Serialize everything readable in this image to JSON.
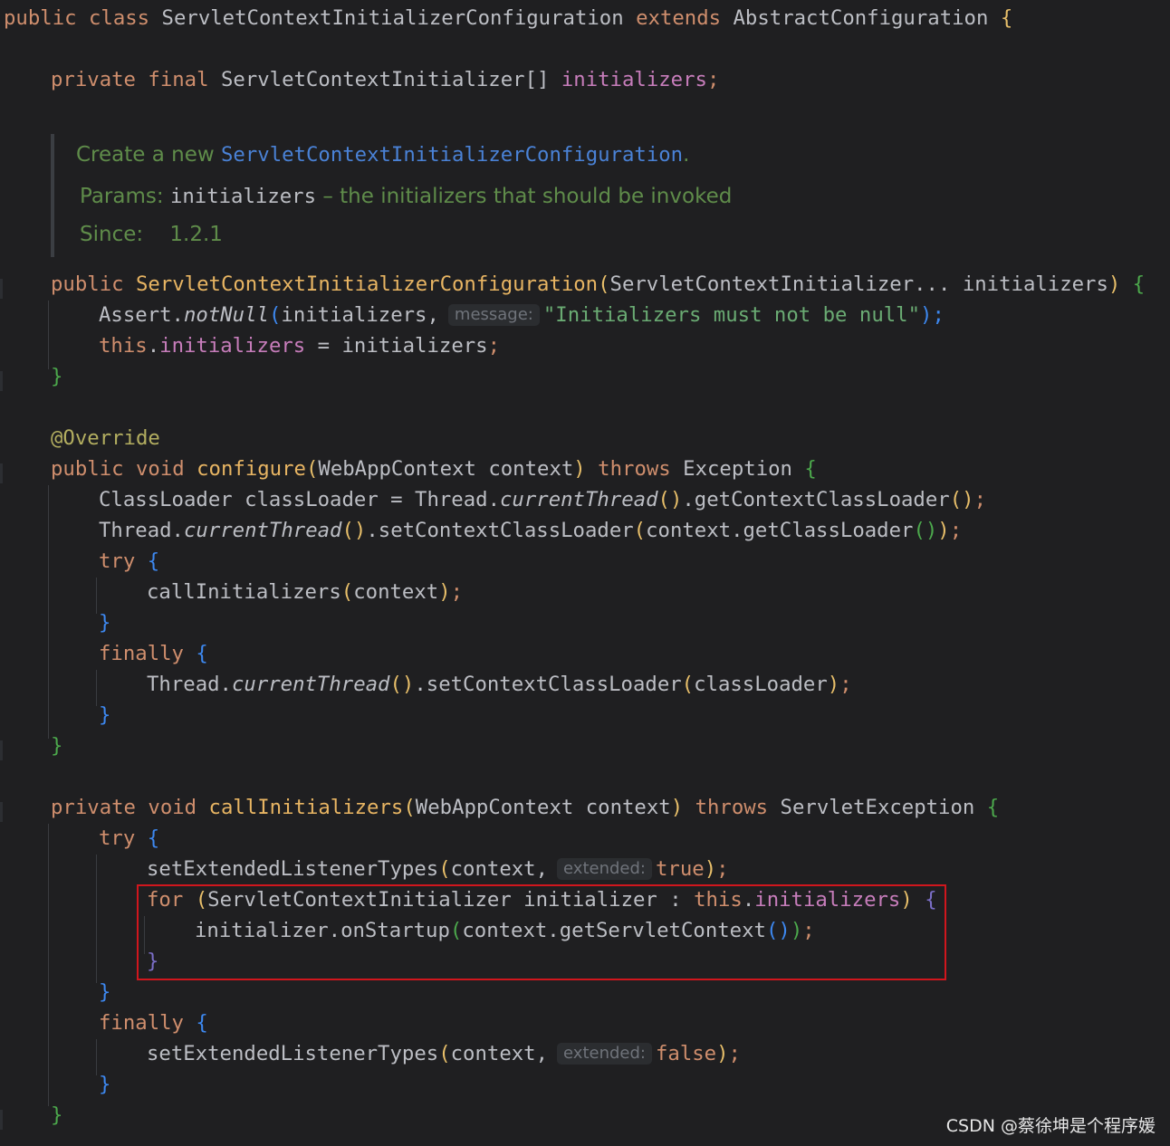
{
  "editor": {
    "class_decl": {
      "kw_public": "public",
      "kw_class": "class",
      "name": "ServletContextInitializerConfiguration",
      "kw_extends": "extends",
      "parent": "AbstractConfiguration",
      "brace": "{"
    },
    "field_decl": {
      "kw_private": "private",
      "kw_final": "final",
      "type": "ServletContextInitializer[]",
      "name": "initializers",
      "semi": ";"
    },
    "javadoc": {
      "line1_prefix": "Create a new ",
      "line1_link": "ServletContextInitializerConfiguration",
      "line1_suffix": ".",
      "params_label": "Params:",
      "params_name": "initializers",
      "params_desc": " – the initializers that should be invoked",
      "since_label": "Since:",
      "since_value": "1.2.1"
    },
    "ctor": {
      "kw_public": "public",
      "name": "ServletContextInitializerConfiguration",
      "params": "ServletContextInitializer... initializers",
      "open": "(",
      "close": ")",
      "brace": "{",
      "assert_obj": "Assert",
      "assert_fn": "notNull",
      "assert_arg": "initializers,",
      "hint_message": "message:",
      "assert_str": "\"Initializers must not be null\"",
      "assert_end": ");",
      "this_kw": "this",
      "this_field": "initializers",
      "assign_rhs": " = initializers",
      "semi": ";",
      "close_brace": "}"
    },
    "configure": {
      "annotation": "@Override",
      "kw_public": "public",
      "kw_void": "void",
      "name": "configure",
      "params": "WebAppContext context",
      "kw_throws": "throws",
      "exception": "Exception",
      "brace": "{",
      "line1_a": "ClassLoader classLoader = Thread.",
      "line1_b": "currentThread",
      "line1_c": ".getContextClassLoader",
      "line2_a": "Thread.",
      "line2_b": "currentThread",
      "line2_c": ".setContextClassLoader",
      "line2_d": "context.getClassLoader",
      "kw_try": "try",
      "call_init": "callInitializers",
      "call_arg": "context",
      "kw_finally": "finally",
      "line3_a": "Thread.",
      "line3_b": "currentThread",
      "line3_c": ".setContextClassLoader",
      "line3_d": "classLoader",
      "close_brace": "}"
    },
    "call_initializers": {
      "kw_private": "private",
      "kw_void": "void",
      "name": "callInitializers",
      "params": "WebAppContext context",
      "kw_throws": "throws",
      "exception": "ServletException",
      "brace": "{",
      "kw_try": "try",
      "set_ext": "setExtendedListenerTypes",
      "set_ext_arg": "context,",
      "hint_extended": "extended:",
      "kw_true": "true",
      "kw_false": "false",
      "kw_for": "for",
      "for_decl": "ServletContextInitializer initializer : ",
      "this_kw": "this",
      "this_field": "initializers",
      "on_startup_a": "initializer.onStartup",
      "on_startup_b": "context.getServletContext",
      "kw_finally": "finally",
      "close_brace": "}"
    }
  },
  "watermark": "CSDN @蔡徐坤是个程序媛",
  "colors": {
    "background": "#1f1f21",
    "keyword": "#cf8e6d",
    "field": "#c77dbb",
    "function": "#e8b563",
    "string": "#6aab73",
    "javadoc": "#5f8c4a",
    "highlight_box": "#d0161d"
  }
}
